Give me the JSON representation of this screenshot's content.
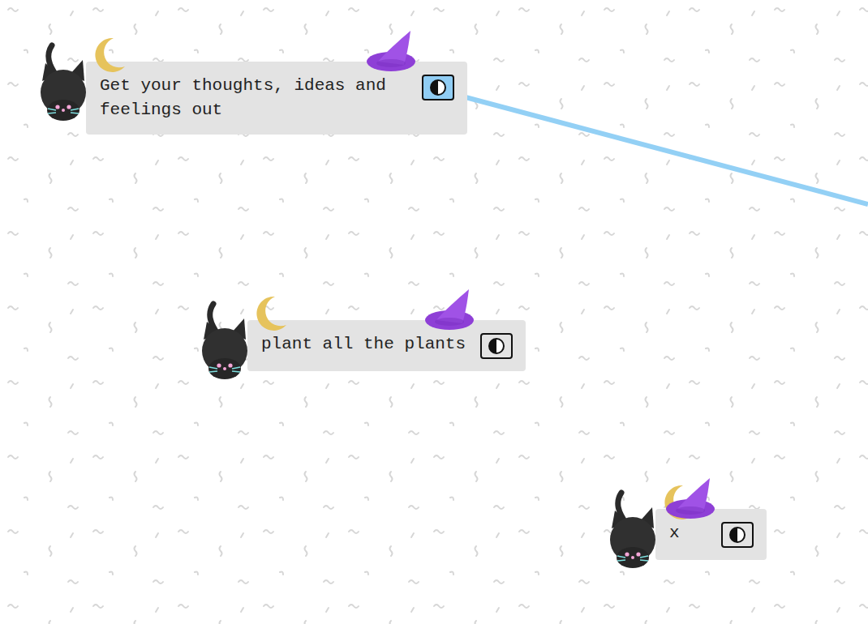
{
  "nodes": [
    {
      "text": "Get your thoughts, ideas and feelings out",
      "toggle_active": true,
      "connected": true
    },
    {
      "text": "plant all the plants",
      "toggle_active": false,
      "connected": false
    },
    {
      "text": "x",
      "toggle_active": false,
      "connected": false
    }
  ]
}
